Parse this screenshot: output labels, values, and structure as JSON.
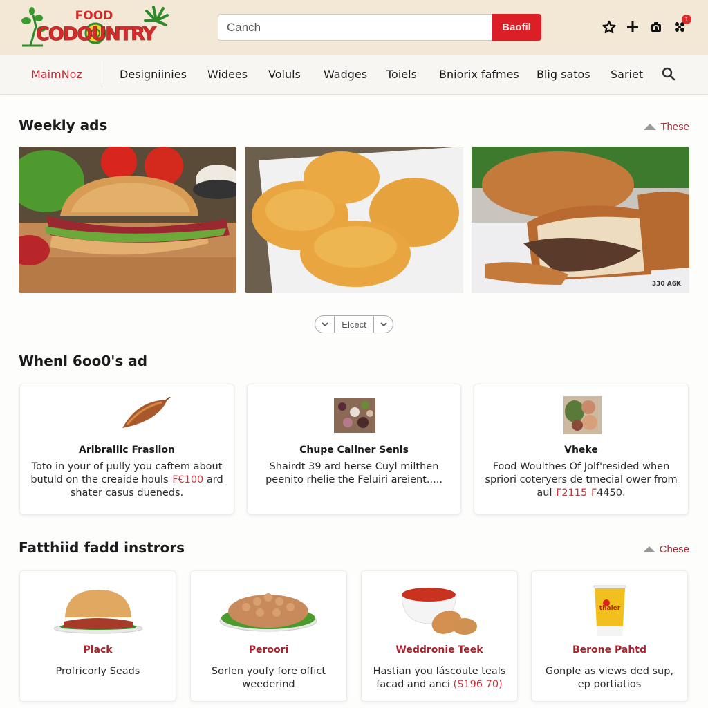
{
  "header": {
    "logo": {
      "top_text": "FOOD",
      "main_text": "CODOUNTRY"
    },
    "search": {
      "placeholder": "Canch",
      "button_label": "Baofil"
    },
    "icons": [
      "star-icon",
      "plus-icon",
      "bag-icon",
      "notification-icon"
    ],
    "notification_badge": "1"
  },
  "nav": {
    "items": [
      {
        "label": "MaimNoz",
        "active": true
      },
      {
        "label": "Designiinies"
      },
      {
        "label": "Widees"
      },
      {
        "label": "Voluls"
      },
      {
        "label": "Wadges"
      },
      {
        "label": "Toiels"
      },
      {
        "label": "Bniorix fafmes"
      },
      {
        "label": "Blig satos"
      },
      {
        "label": "Sariet"
      }
    ]
  },
  "weekly_ads": {
    "title": "Weekly ads",
    "link_label": "These",
    "images": [
      {
        "name": "sandwich"
      },
      {
        "name": "cheese-bread"
      },
      {
        "name": "meat-loaf",
        "caption": "330 A6K"
      }
    ],
    "pager": {
      "label": "Elcect"
    }
  },
  "section2": {
    "title": "Whenl 6oo0's ad",
    "cards": [
      {
        "title": "Aribrallic Frasiion",
        "desc_parts": [
          "Toto in your of µully you caftem about butuld on the creaide houls ",
          "₣€100",
          " ard shater casus dueneds."
        ]
      },
      {
        "title": "Chupe Caliner Senls",
        "desc_parts": [
          "Shairdt 39 ard herse Cuyl milthen peenito rhelie the Feluiri areient.....",
          "",
          ""
        ]
      },
      {
        "title": "Vheke",
        "desc_parts": [
          "Food Woulthes Of Jolf'resided when spriori coteryers de tmecial ower from aul ",
          "₣2115 ₣",
          "4450."
        ]
      }
    ]
  },
  "section3": {
    "title": "Fatthiid fadd instrors",
    "link_label": "Chese",
    "cards": [
      {
        "title": "Plack",
        "desc": "Profricorly Seads",
        "price": ""
      },
      {
        "title": "Peroori",
        "desc": "Sorlen youfy fore offict weederind",
        "price": ""
      },
      {
        "title": "Weddronie Teek",
        "desc": "Hastian you láscoute teals facad and anci ",
        "price": "(S196 70)"
      },
      {
        "title": "Berone Pahtd",
        "desc": "Gonple as views ded sup, ep portiatios",
        "price": "",
        "cup_label": "thaler"
      }
    ]
  }
}
